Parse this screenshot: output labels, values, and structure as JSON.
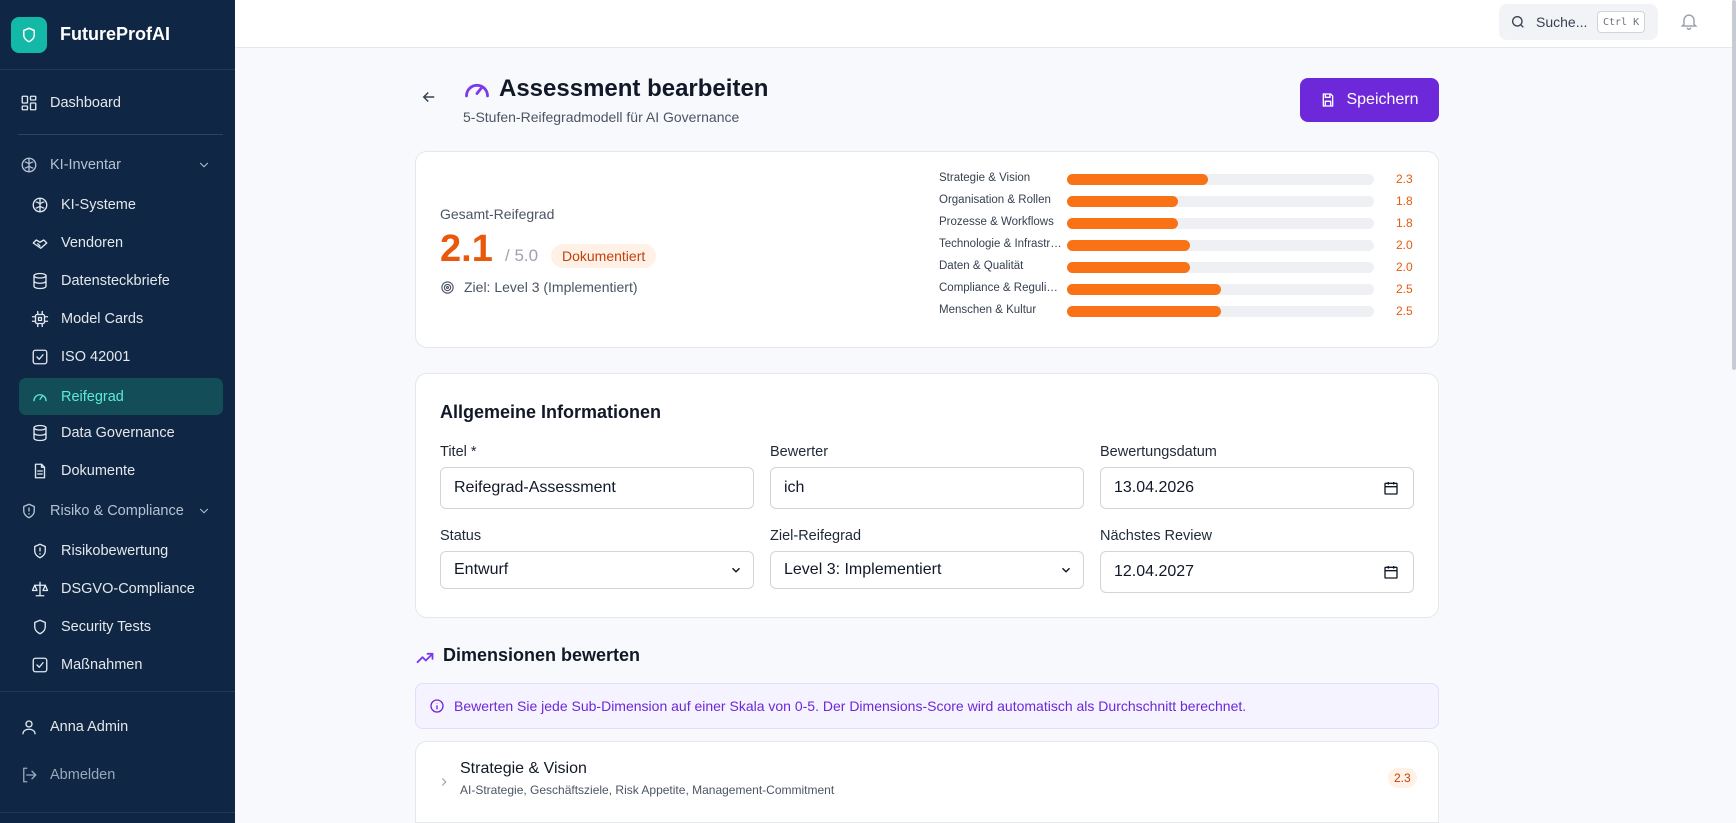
{
  "app": {
    "name": "FutureProfAI"
  },
  "sidebar": {
    "dashboard": "Dashboard",
    "group_inventory": "KI-Inventar",
    "ki_systeme": "KI-Systeme",
    "vendoren": "Vendoren",
    "datensteckbriefe": "Datensteckbriefe",
    "model_cards": "Model Cards",
    "iso": "ISO 42001",
    "reifegrad": "Reifegrad",
    "data_governance": "Data Governance",
    "dokumente": "Dokumente",
    "group_risk": "Risiko & Compliance",
    "risikobewertung": "Risikobewertung",
    "dsgvo": "DSGVO-Compliance",
    "security_tests": "Security Tests",
    "massnahmen": "Maßnahmen",
    "user": "Anna Admin",
    "logout": "Abmelden",
    "active": "reifegrad"
  },
  "topbar": {
    "search_placeholder": "Suche...",
    "shortcut": "Ctrl K"
  },
  "header": {
    "title": "Assessment bearbeiten",
    "subtitle": "5-Stufen-Reifegradmodell für AI Governance",
    "save_label": "Speichern"
  },
  "summary": {
    "label": "Gesamt-Reifegrad",
    "value": "2.1",
    "max": "/ 5.0",
    "badge": "Dokumentiert",
    "target": "Ziel: Level 3 (Implementiert)",
    "scale_max": 5,
    "dimensions": [
      {
        "name": "Strategie & Vision",
        "score": 2.3,
        "label": "2.3"
      },
      {
        "name": "Organisation & Rollen",
        "score": 1.8,
        "label": "1.8"
      },
      {
        "name": "Prozesse & Workflows",
        "score": 1.8,
        "label": "1.8"
      },
      {
        "name": "Technologie & Infrastruktur",
        "score": 2.0,
        "label": "2.0"
      },
      {
        "name": "Daten & Qualität",
        "score": 2.0,
        "label": "2.0"
      },
      {
        "name": "Compliance & Regulierung",
        "score": 2.5,
        "label": "2.5"
      },
      {
        "name": "Menschen & Kultur",
        "score": 2.5,
        "label": "2.5"
      }
    ],
    "bar_color": "#f97316"
  },
  "form": {
    "title": "Allgemeine Informationen",
    "titel_label": "Titel *",
    "titel_value": "Reifegrad-Assessment",
    "bewerter_label": "Bewerter",
    "bewerter_value": "ich",
    "datum_label": "Bewertungsdatum",
    "datum_value": "13.04.2026",
    "status_label": "Status",
    "status_value": "Entwurf",
    "ziel_label": "Ziel-Reifegrad",
    "ziel_value": "Level 3: Implementiert",
    "review_label": "Nächstes Review",
    "review_value": "12.04.2027"
  },
  "dimensions_section": {
    "title": "Dimensionen bewerten",
    "info": "Bewerten Sie jede Sub-Dimension auf einer Skala von 0-5. Der Dimensions-Score wird automatisch als Durchschnitt berechnet.",
    "items": [
      {
        "title": "Strategie & Vision",
        "subtitle": "AI-Strategie, Geschäftsziele, Risk Appetite, Management-Commitment",
        "score": "2.3"
      }
    ]
  },
  "colors": {
    "accent": "#6d28d9",
    "sidebar": "#0f2744",
    "active": "#5eead4",
    "score": "#ea580c"
  }
}
